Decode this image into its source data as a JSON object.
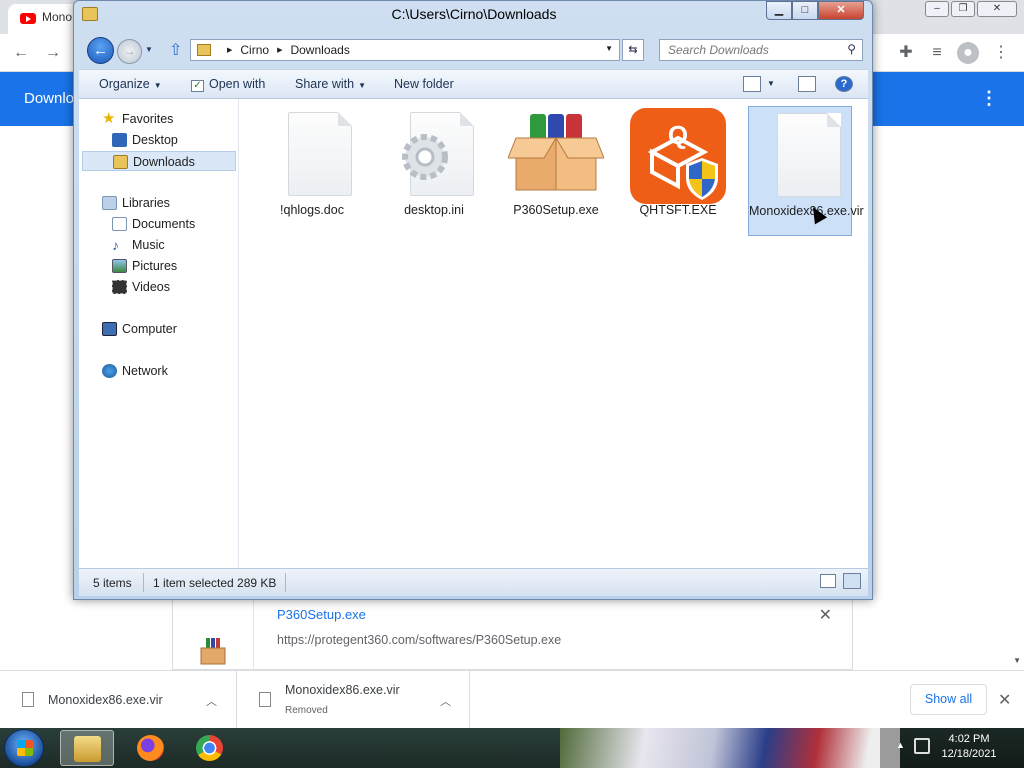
{
  "chrome": {
    "tab_title": "Mono",
    "page_header_title": "Downlo",
    "download_card": {
      "filename": "P360Setup.exe",
      "url": "https://protegent360.com/softwares/P360Setup.exe"
    }
  },
  "explorer": {
    "title": "C:\\Users\\Cirno\\Downloads",
    "breadcrumb": [
      "Cirno",
      "Downloads"
    ],
    "search_placeholder": "Search Downloads",
    "toolbar": {
      "organize": "Organize",
      "open_with": "Open with",
      "share_with": "Share with",
      "new_folder": "New folder"
    },
    "nav": {
      "favorites": "Favorites",
      "desktop": "Desktop",
      "downloads": "Downloads",
      "libraries": "Libraries",
      "documents": "Documents",
      "music": "Music",
      "pictures": "Pictures",
      "videos": "Videos",
      "computer": "Computer",
      "network": "Network"
    },
    "files": [
      {
        "name": "!qhlogs.doc",
        "icon": "document-icon"
      },
      {
        "name": "desktop.ini",
        "icon": "settings-file-icon"
      },
      {
        "name": "P360Setup.exe",
        "icon": "installer-box-icon"
      },
      {
        "name": "QHTSFT.EXE",
        "icon": "quickheal-shield-icon"
      },
      {
        "name": "Monoxidex86.exe.vir",
        "icon": "document-icon"
      }
    ],
    "status": {
      "items": "5 items",
      "selected": "1 item selected  289 KB"
    }
  },
  "shelf": {
    "item1": "Monoxidex86.exe.vir",
    "item2": "Monoxidex86.exe.vir",
    "item2_status": "Removed",
    "show_all": "Show all"
  },
  "taskbar": {
    "time": "4:02 PM",
    "date": "12/18/2021"
  }
}
